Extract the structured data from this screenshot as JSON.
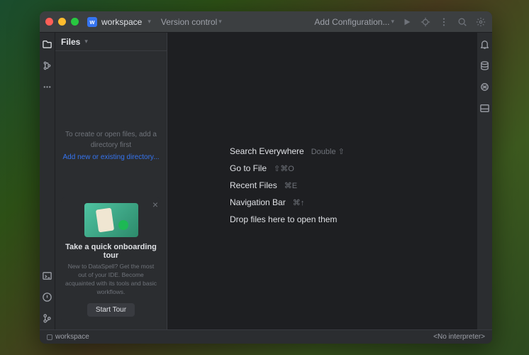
{
  "titlebar": {
    "project_name": "workspace",
    "vcs_label": "Version control",
    "add_config": "Add Configuration..."
  },
  "sidebar": {
    "header": "Files",
    "empty_text": "To create or open files, add a directory first",
    "empty_link": "Add new or existing directory..."
  },
  "onboarding": {
    "title": "Take a quick onboarding tour",
    "desc": "New to DataSpell? Get the most out of your IDE. Become acquainted with its tools and basic workflows.",
    "button": "Start Tour"
  },
  "welcome": {
    "items": [
      {
        "label": "Search Everywhere",
        "shortcut": "Double ⇧"
      },
      {
        "label": "Go to File",
        "shortcut": "⇧⌘O"
      },
      {
        "label": "Recent Files",
        "shortcut": "⌘E"
      },
      {
        "label": "Navigation Bar",
        "shortcut": "⌘↑"
      },
      {
        "label": "Drop files here to open them",
        "shortcut": ""
      }
    ]
  },
  "statusbar": {
    "project": "workspace",
    "interpreter": "<No interpreter>"
  }
}
